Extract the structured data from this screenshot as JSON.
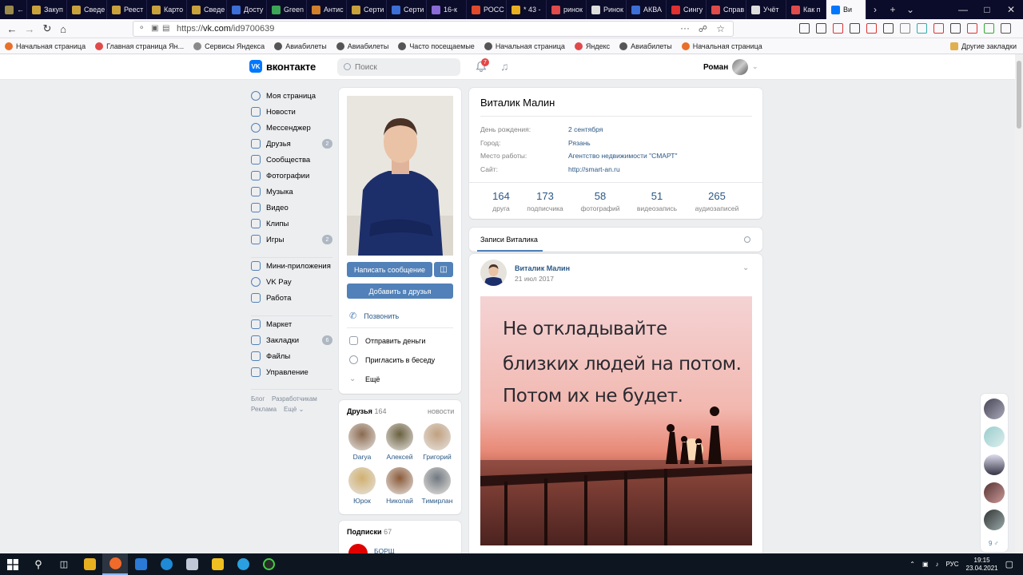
{
  "browser": {
    "tabs": [
      {
        "label": "← нь",
        "color": "#9a8a4a"
      },
      {
        "label": "Закуп",
        "color": "#c9a13b"
      },
      {
        "label": "Сведе",
        "color": "#c9a13b"
      },
      {
        "label": "Реест",
        "color": "#c9a13b"
      },
      {
        "label": "Карто",
        "color": "#c9a13b"
      },
      {
        "label": "Сведе",
        "color": "#c9a13b"
      },
      {
        "label": "Досту",
        "color": "#3b6fd6"
      },
      {
        "label": "Green",
        "color": "#3aa655"
      },
      {
        "label": "Антис",
        "color": "#d0802a"
      },
      {
        "label": "Серти",
        "color": "#c9a13b"
      },
      {
        "label": "Серти",
        "color": "#3b6fd6"
      },
      {
        "label": "16-к",
        "color": "#8a6ad6"
      },
      {
        "label": "РОСС",
        "color": "#e04a2a"
      },
      {
        "label": "* 43 -",
        "color": "#e8b020"
      },
      {
        "label": "ринок",
        "color": "#e04a4a"
      },
      {
        "label": "Ринок",
        "color": "#dddddd"
      },
      {
        "label": "АКВА",
        "color": "#3b6fd6"
      },
      {
        "label": "Сингу",
        "color": "#e03030"
      },
      {
        "label": "Справ",
        "color": "#e04a4a"
      },
      {
        "label": "Учёт",
        "color": "#dddddd"
      },
      {
        "label": "Как п",
        "color": "#e04a4a"
      },
      {
        "label": "Ви",
        "color": "#0077ff",
        "active": true
      }
    ],
    "url_prefix": "https://",
    "url_host": "vk.com",
    "url_path": "/id9700639",
    "more_dots": "···",
    "bookmarks": [
      {
        "label": "Начальная страница",
        "color": "#e8702a"
      },
      {
        "label": "Главная страница Ян...",
        "color": "#e04a4a"
      },
      {
        "label": "Сервисы Яндекса",
        "color": "#8a8a8a"
      },
      {
        "label": "Авиабилеты",
        "color": "#555555"
      },
      {
        "label": "Авиабилеты",
        "color": "#555555"
      },
      {
        "label": "Часто посещаемые",
        "color": "#555555"
      },
      {
        "label": "Начальная страница",
        "color": "#555555"
      },
      {
        "label": "Яндекс",
        "color": "#e04a4a"
      },
      {
        "label": "Авиабилеты",
        "color": "#555555"
      },
      {
        "label": "Начальная страница",
        "color": "#e8702a"
      }
    ],
    "other_bookmarks": "Другие закладки"
  },
  "vk": {
    "logo_text": "вконтакте",
    "logo_mark": "VK",
    "search_placeholder": "Поиск",
    "notif_count": "7",
    "user_name": "Роман",
    "menu": [
      {
        "label": "Моя страница",
        "top": 0
      },
      {
        "label": "Новости"
      },
      {
        "label": "Мессенджер"
      },
      {
        "label": "Друзья",
        "badge": "2"
      },
      {
        "label": "Сообщества"
      },
      {
        "label": "Фотографии"
      },
      {
        "label": "Музыка"
      },
      {
        "label": "Видео"
      },
      {
        "label": "Клипы"
      },
      {
        "label": "Игры",
        "badge": "2"
      },
      {
        "label": "Мини-приложения"
      },
      {
        "label": "VK Pay"
      },
      {
        "label": "Работа"
      },
      {
        "label": "Маркет"
      },
      {
        "label": "Закладки",
        "badge": "6"
      },
      {
        "label": "Файлы"
      },
      {
        "label": "Управление"
      }
    ],
    "footer": {
      "blog": "Блог",
      "devs": "Разработчикам",
      "ads": "Реклама",
      "more": "Ещё ⌄"
    },
    "profile": {
      "send_message": "Написать сообщение",
      "gift_icon": "gift-icon",
      "add_friend": "Добавить в друзья",
      "call": "Позвонить",
      "send_money": "Отправить деньги",
      "invite_chat": "Пригласить в беседу",
      "more": "Ещё"
    },
    "friends": {
      "title": "Друзья",
      "count": "164",
      "news_link": "новости",
      "items": [
        {
          "name": "Darya",
          "color": "#8a6a50"
        },
        {
          "name": "Алексей",
          "color": "#6a6040"
        },
        {
          "name": "Григорий",
          "color": "#c0a080"
        },
        {
          "name": "Юрок",
          "color": "#d0b070"
        },
        {
          "name": "Николай",
          "color": "#8a5a3a"
        },
        {
          "name": "Тимирлан",
          "color": "#707880"
        }
      ]
    },
    "subs": {
      "title": "Подписки",
      "count": "67",
      "first": "БОРЩ"
    },
    "user": {
      "full_name": "Виталик Малин",
      "info": [
        {
          "label": "День рождения:",
          "value": "2 сентября"
        },
        {
          "label": "Город:",
          "value": "Рязань"
        },
        {
          "label": "Место работы:",
          "value": "Агентство недвижимости \"СМАРТ\""
        },
        {
          "label": "Сайт:",
          "value": "http://smart-an.ru"
        }
      ],
      "stats": [
        {
          "n": "164",
          "l": "друга"
        },
        {
          "n": "173",
          "l": "подписчика"
        },
        {
          "n": "58",
          "l": "фотографий"
        },
        {
          "n": "51",
          "l": "видеозапись"
        },
        {
          "n": "265",
          "l": "аудиозаписей"
        }
      ]
    },
    "wall": {
      "tab": "Записи Виталика",
      "post_author": "Виталик Малин",
      "post_date": "21 июл 2017",
      "image_lines": [
        "Не откладывайте",
        "близких людей на потом.",
        "Потом их не будет."
      ]
    },
    "chat_count": "9 ♂"
  },
  "taskbar": {
    "lang": "РУС",
    "time": "19:15",
    "date": "23.04.2021"
  }
}
